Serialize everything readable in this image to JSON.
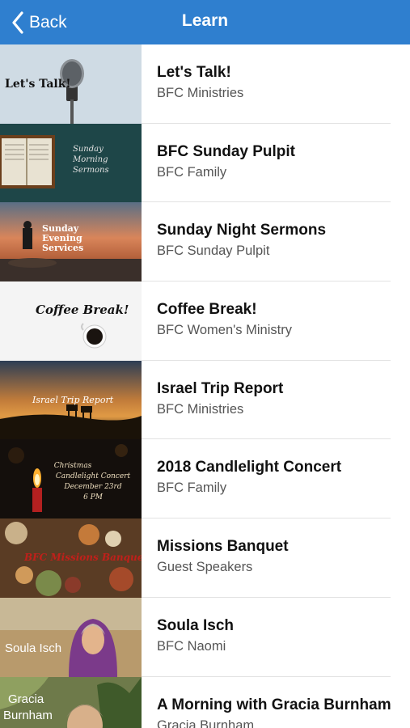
{
  "nav": {
    "back_label": "Back",
    "title": "Learn",
    "color": "#2f7fcf"
  },
  "items": [
    {
      "title": "Let's Talk!",
      "subtitle": "BFC Ministries",
      "thumb_text": "Let's Talk!"
    },
    {
      "title": "BFC Sunday Pulpit",
      "subtitle": "BFC Family",
      "thumb_text": "Sunday Morning Sermons"
    },
    {
      "title": "Sunday Night Sermons",
      "subtitle": "BFC Sunday Pulpit",
      "thumb_text": "Sunday Evening Services"
    },
    {
      "title": "Coffee Break!",
      "subtitle": "BFC Women's Ministry",
      "thumb_text": "Coffee Break!"
    },
    {
      "title": "Israel Trip Report",
      "subtitle": "BFC Ministries",
      "thumb_text": "Israel Trip Report"
    },
    {
      "title": "2018 Candlelight Concert",
      "subtitle": "BFC Family",
      "thumb_text": "Christmas Candlelight Concert December 23rd 6 PM"
    },
    {
      "title": "Missions Banquet",
      "subtitle": "Guest Speakers",
      "thumb_text": "BFC Missions Banquet"
    },
    {
      "title": "Soula Isch",
      "subtitle": "BFC Naomi",
      "thumb_text": "Soula Isch"
    },
    {
      "title": "A Morning with Gracia Burnham",
      "subtitle": "Gracia Burnham",
      "thumb_text": "Gracia Burnham"
    }
  ]
}
